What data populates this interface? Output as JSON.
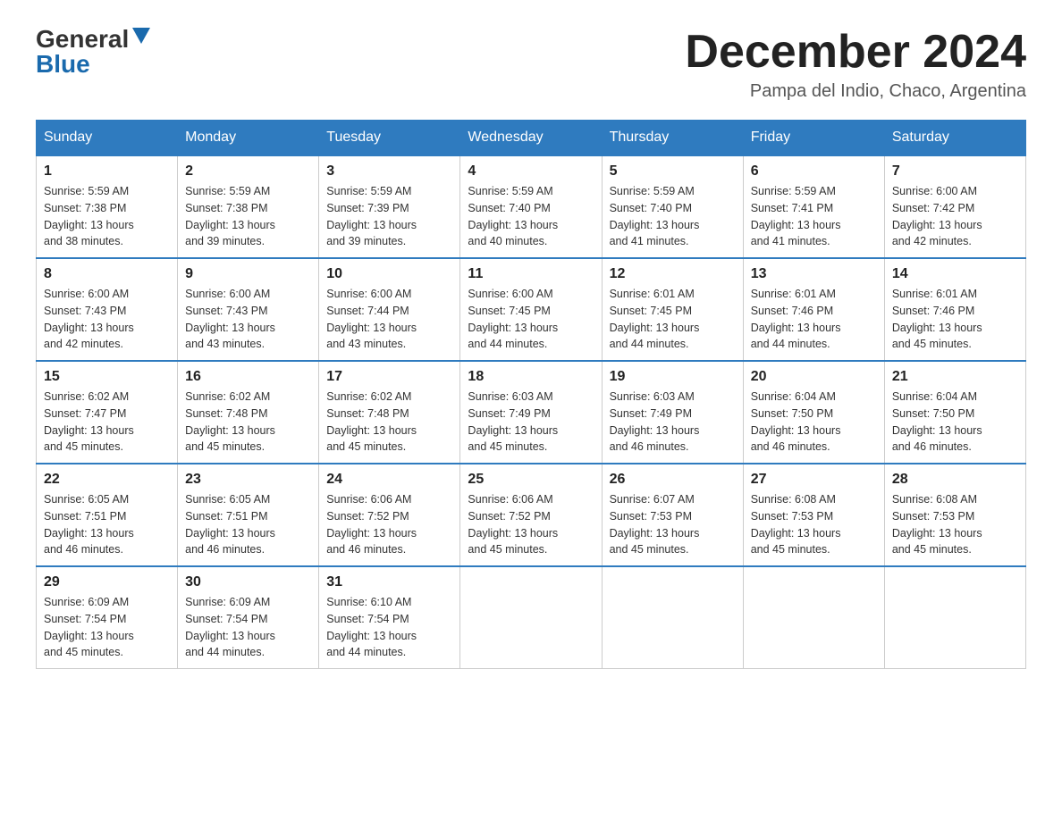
{
  "header": {
    "logo_general": "General",
    "logo_blue": "Blue",
    "month_title": "December 2024",
    "subtitle": "Pampa del Indio, Chaco, Argentina"
  },
  "days_of_week": [
    "Sunday",
    "Monday",
    "Tuesday",
    "Wednesday",
    "Thursday",
    "Friday",
    "Saturday"
  ],
  "weeks": [
    [
      {
        "day": "1",
        "sunrise": "5:59 AM",
        "sunset": "7:38 PM",
        "daylight": "13 hours and 38 minutes."
      },
      {
        "day": "2",
        "sunrise": "5:59 AM",
        "sunset": "7:38 PM",
        "daylight": "13 hours and 39 minutes."
      },
      {
        "day": "3",
        "sunrise": "5:59 AM",
        "sunset": "7:39 PM",
        "daylight": "13 hours and 39 minutes."
      },
      {
        "day": "4",
        "sunrise": "5:59 AM",
        "sunset": "7:40 PM",
        "daylight": "13 hours and 40 minutes."
      },
      {
        "day": "5",
        "sunrise": "5:59 AM",
        "sunset": "7:40 PM",
        "daylight": "13 hours and 41 minutes."
      },
      {
        "day": "6",
        "sunrise": "5:59 AM",
        "sunset": "7:41 PM",
        "daylight": "13 hours and 41 minutes."
      },
      {
        "day": "7",
        "sunrise": "6:00 AM",
        "sunset": "7:42 PM",
        "daylight": "13 hours and 42 minutes."
      }
    ],
    [
      {
        "day": "8",
        "sunrise": "6:00 AM",
        "sunset": "7:43 PM",
        "daylight": "13 hours and 42 minutes."
      },
      {
        "day": "9",
        "sunrise": "6:00 AM",
        "sunset": "7:43 PM",
        "daylight": "13 hours and 43 minutes."
      },
      {
        "day": "10",
        "sunrise": "6:00 AM",
        "sunset": "7:44 PM",
        "daylight": "13 hours and 43 minutes."
      },
      {
        "day": "11",
        "sunrise": "6:00 AM",
        "sunset": "7:45 PM",
        "daylight": "13 hours and 44 minutes."
      },
      {
        "day": "12",
        "sunrise": "6:01 AM",
        "sunset": "7:45 PM",
        "daylight": "13 hours and 44 minutes."
      },
      {
        "day": "13",
        "sunrise": "6:01 AM",
        "sunset": "7:46 PM",
        "daylight": "13 hours and 44 minutes."
      },
      {
        "day": "14",
        "sunrise": "6:01 AM",
        "sunset": "7:46 PM",
        "daylight": "13 hours and 45 minutes."
      }
    ],
    [
      {
        "day": "15",
        "sunrise": "6:02 AM",
        "sunset": "7:47 PM",
        "daylight": "13 hours and 45 minutes."
      },
      {
        "day": "16",
        "sunrise": "6:02 AM",
        "sunset": "7:48 PM",
        "daylight": "13 hours and 45 minutes."
      },
      {
        "day": "17",
        "sunrise": "6:02 AM",
        "sunset": "7:48 PM",
        "daylight": "13 hours and 45 minutes."
      },
      {
        "day": "18",
        "sunrise": "6:03 AM",
        "sunset": "7:49 PM",
        "daylight": "13 hours and 45 minutes."
      },
      {
        "day": "19",
        "sunrise": "6:03 AM",
        "sunset": "7:49 PM",
        "daylight": "13 hours and 46 minutes."
      },
      {
        "day": "20",
        "sunrise": "6:04 AM",
        "sunset": "7:50 PM",
        "daylight": "13 hours and 46 minutes."
      },
      {
        "day": "21",
        "sunrise": "6:04 AM",
        "sunset": "7:50 PM",
        "daylight": "13 hours and 46 minutes."
      }
    ],
    [
      {
        "day": "22",
        "sunrise": "6:05 AM",
        "sunset": "7:51 PM",
        "daylight": "13 hours and 46 minutes."
      },
      {
        "day": "23",
        "sunrise": "6:05 AM",
        "sunset": "7:51 PM",
        "daylight": "13 hours and 46 minutes."
      },
      {
        "day": "24",
        "sunrise": "6:06 AM",
        "sunset": "7:52 PM",
        "daylight": "13 hours and 46 minutes."
      },
      {
        "day": "25",
        "sunrise": "6:06 AM",
        "sunset": "7:52 PM",
        "daylight": "13 hours and 45 minutes."
      },
      {
        "day": "26",
        "sunrise": "6:07 AM",
        "sunset": "7:53 PM",
        "daylight": "13 hours and 45 minutes."
      },
      {
        "day": "27",
        "sunrise": "6:08 AM",
        "sunset": "7:53 PM",
        "daylight": "13 hours and 45 minutes."
      },
      {
        "day": "28",
        "sunrise": "6:08 AM",
        "sunset": "7:53 PM",
        "daylight": "13 hours and 45 minutes."
      }
    ],
    [
      {
        "day": "29",
        "sunrise": "6:09 AM",
        "sunset": "7:54 PM",
        "daylight": "13 hours and 45 minutes."
      },
      {
        "day": "30",
        "sunrise": "6:09 AM",
        "sunset": "7:54 PM",
        "daylight": "13 hours and 44 minutes."
      },
      {
        "day": "31",
        "sunrise": "6:10 AM",
        "sunset": "7:54 PM",
        "daylight": "13 hours and 44 minutes."
      },
      null,
      null,
      null,
      null
    ]
  ],
  "labels": {
    "sunrise": "Sunrise:",
    "sunset": "Sunset:",
    "daylight": "Daylight:"
  },
  "colors": {
    "header_bg": "#2f7bbf",
    "header_text": "#ffffff",
    "border_top": "#2f7bbf"
  }
}
